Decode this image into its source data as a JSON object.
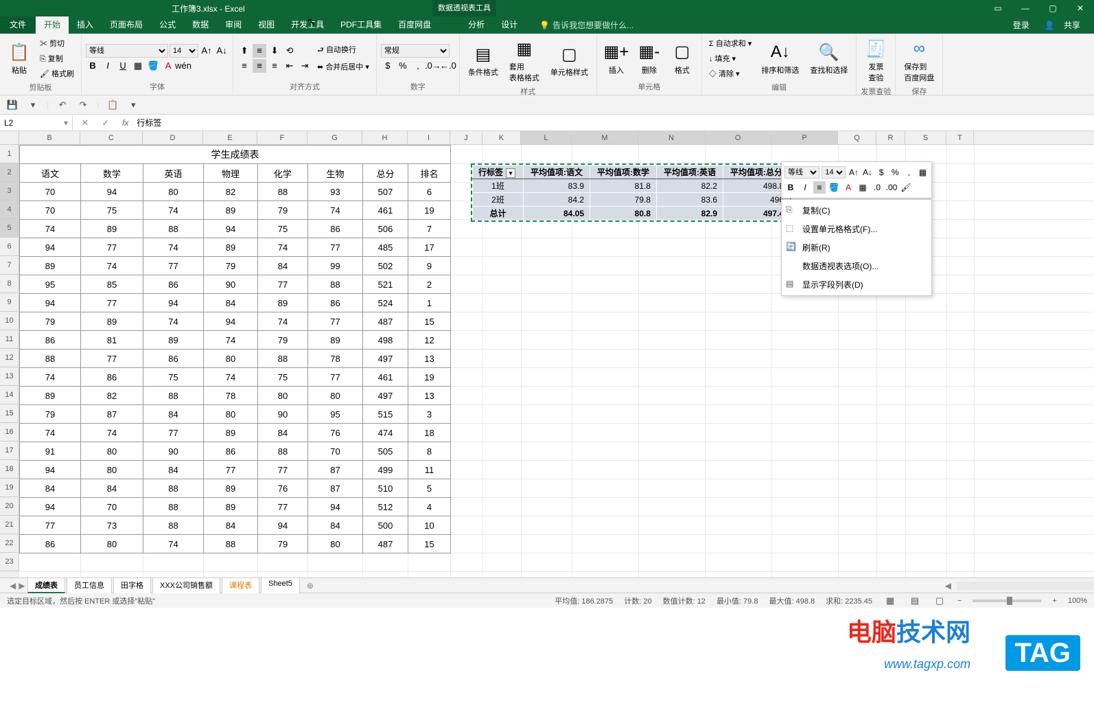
{
  "title": "工作簿3.xlsx - Excel",
  "pivot_tool_title": "数据透视表工具",
  "tabs": {
    "file": "文件",
    "home": "开始",
    "insert": "插入",
    "layout": "页面布局",
    "formulas": "公式",
    "data": "数据",
    "review": "审阅",
    "view": "视图",
    "dev": "开发工具",
    "pdf": "PDF工具集",
    "baidu": "百度网盘",
    "analyze": "分析",
    "design": "设计"
  },
  "tell_me": "告诉我您想要做什么...",
  "login": "登录",
  "share": "共享",
  "ribbon": {
    "clipboard": {
      "paste": "粘贴",
      "cut": "剪切",
      "copy": "复制",
      "painter": "格式刷",
      "label": "剪贴板"
    },
    "font": {
      "name": "等线",
      "size": "14",
      "label": "字体"
    },
    "align": {
      "wrap": "自动换行",
      "merge": "合并后居中",
      "label": "对齐方式"
    },
    "number": {
      "format": "常规",
      "label": "数字"
    },
    "styles": {
      "cond": "条件格式",
      "table": "套用\n表格格式",
      "cell": "单元格样式",
      "label": "样式"
    },
    "cells": {
      "insert": "插入",
      "delete": "删除",
      "format": "格式",
      "label": "单元格"
    },
    "editing": {
      "sum": "自动求和",
      "fill": "填充",
      "clear": "清除",
      "sort": "排序和筛选",
      "find": "查找和选择",
      "label": "编辑"
    },
    "invoice": {
      "label1": "发票\n查验",
      "group": "发票查验"
    },
    "baidu": {
      "label1": "保存到\n百度网盘",
      "group": "保存"
    }
  },
  "name_box": "L2",
  "formula": "行标签",
  "columns": [
    "B",
    "C",
    "D",
    "E",
    "F",
    "G",
    "H",
    "I",
    "J",
    "K",
    "L",
    "M",
    "N",
    "O",
    "P",
    "Q",
    "R",
    "S",
    "T"
  ],
  "main_title": "学生成绩表",
  "main_headers": [
    "语文",
    "数学",
    "英语",
    "物理",
    "化学",
    "生物",
    "总分",
    "排名"
  ],
  "main_data": [
    [
      "70",
      "94",
      "80",
      "82",
      "88",
      "93",
      "507",
      "6"
    ],
    [
      "70",
      "75",
      "74",
      "89",
      "79",
      "74",
      "461",
      "19"
    ],
    [
      "74",
      "89",
      "88",
      "94",
      "75",
      "86",
      "506",
      "7"
    ],
    [
      "94",
      "77",
      "74",
      "89",
      "74",
      "77",
      "485",
      "17"
    ],
    [
      "89",
      "74",
      "77",
      "79",
      "84",
      "99",
      "502",
      "9"
    ],
    [
      "95",
      "85",
      "86",
      "90",
      "77",
      "88",
      "521",
      "2"
    ],
    [
      "94",
      "77",
      "94",
      "84",
      "89",
      "86",
      "524",
      "1"
    ],
    [
      "79",
      "89",
      "74",
      "94",
      "74",
      "77",
      "487",
      "15"
    ],
    [
      "86",
      "81",
      "89",
      "74",
      "79",
      "89",
      "498",
      "12"
    ],
    [
      "88",
      "77",
      "86",
      "80",
      "88",
      "78",
      "497",
      "13"
    ],
    [
      "74",
      "86",
      "75",
      "74",
      "75",
      "77",
      "461",
      "19"
    ],
    [
      "89",
      "82",
      "88",
      "78",
      "80",
      "80",
      "497",
      "13"
    ],
    [
      "79",
      "87",
      "84",
      "80",
      "90",
      "95",
      "515",
      "3"
    ],
    [
      "74",
      "74",
      "77",
      "89",
      "84",
      "76",
      "474",
      "18"
    ],
    [
      "91",
      "80",
      "90",
      "86",
      "88",
      "70",
      "505",
      "8"
    ],
    [
      "94",
      "80",
      "84",
      "77",
      "77",
      "87",
      "499",
      "11"
    ],
    [
      "84",
      "84",
      "88",
      "89",
      "76",
      "87",
      "510",
      "5"
    ],
    [
      "94",
      "70",
      "88",
      "89",
      "77",
      "94",
      "512",
      "4"
    ],
    [
      "77",
      "73",
      "88",
      "84",
      "94",
      "84",
      "500",
      "10"
    ],
    [
      "86",
      "80",
      "74",
      "88",
      "79",
      "80",
      "487",
      "15"
    ]
  ],
  "pivot_headers": [
    "行标签",
    "平均值项:语文",
    "平均值项:数学",
    "平均值项:英语",
    "平均值项:总分"
  ],
  "pivot_data": [
    [
      "1班",
      "83.9",
      "81.8",
      "82.2",
      "498.8"
    ],
    [
      "2班",
      "84.2",
      "79.8",
      "83.6",
      "496"
    ]
  ],
  "pivot_total": [
    "总计",
    "84.05",
    "80.8",
    "82.9",
    "497.4"
  ],
  "mini_toolbar": {
    "font": "等线",
    "size": "14"
  },
  "context_menu": {
    "copy": "复制(C)",
    "format_cells": "设置单元格格式(F)...",
    "refresh": "刷新(R)",
    "pivot_options": "数据透视表选项(O)...",
    "show_fields": "显示字段列表(D)"
  },
  "sheet_tabs": [
    "成绩表",
    "员工信息",
    "田字格",
    "XXX公司销售额",
    "课程表",
    "Sheet5"
  ],
  "status": {
    "left": "选定目标区域，然后按 ENTER 或选择\"粘贴\"",
    "avg": "平均值: 186.2875",
    "count": "计数: 20",
    "numcount": "数值计数: 12",
    "min": "最小值: 79.8",
    "max": "最大值: 498.8",
    "sum": "求和: 2235.45",
    "zoom": "100%"
  },
  "watermark": {
    "text1a": "电脑",
    "text1b": "技术网",
    "tag": "TAG",
    "url": "www.tagxp.com"
  }
}
